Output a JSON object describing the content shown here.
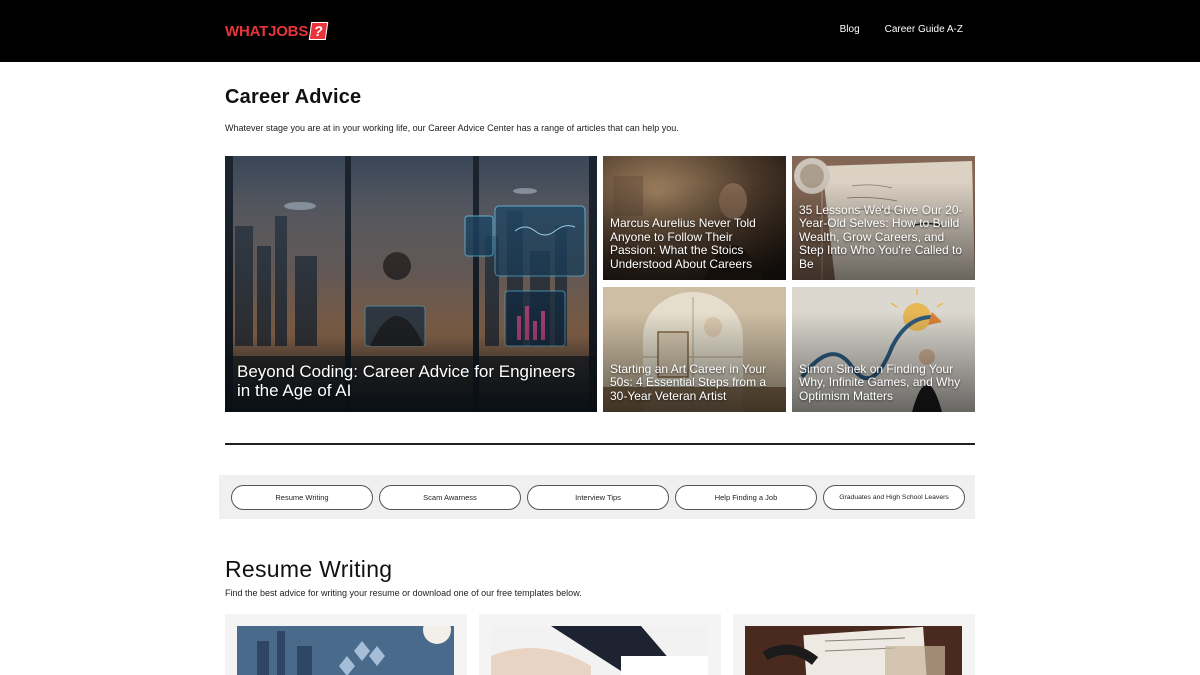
{
  "header": {
    "logo": {
      "text": "WHATJOBS",
      "badge": "?"
    },
    "nav": [
      {
        "label": "Blog"
      },
      {
        "label": "Career Guide A-Z"
      }
    ]
  },
  "hero": {
    "title": "Career Advice",
    "intro": "Whatever stage you are at in your working life, our Career Advice Center has a range of articles that can help you."
  },
  "featured": [
    {
      "title": "Beyond Coding: Career Advice for Engineers in the Age of AI",
      "image": "futuristic-engineer-dashboard"
    },
    {
      "title": "Marcus Aurelius Never Told Anyone to Follow Their Passion: What the Stoics Understood About Careers",
      "image": "stoic-philosopher"
    },
    {
      "title": "35 Lessons We'd Give Our 20-Year-Old Selves: How to Build Wealth, Grow Careers, and Step Into Who You're Called to Be",
      "image": "handwritten-notebook"
    },
    {
      "title": "Starting an Art Career in Your 50s: 4 Essential Steps from a 30-Year Veteran Artist",
      "image": "artist-at-easel"
    },
    {
      "title": "Simon Sinek on Finding Your Why, Infinite Games, and Why Optimism Matters",
      "image": "speaker-on-stage"
    }
  ],
  "categories": [
    {
      "label": "Resume Writing"
    },
    {
      "label": "Scam Awarness"
    },
    {
      "label": "Interview Tips"
    },
    {
      "label": "Help Finding a Job"
    },
    {
      "label": "Graduates and High School Leavers"
    }
  ],
  "section": {
    "title": "Resume Writing",
    "intro": "Find the best advice for writing your resume or download one of our free templates below."
  },
  "resume_cards": [
    {
      "image": "city-skyline-office"
    },
    {
      "image": "handshake-meeting"
    },
    {
      "image": "signing-documents"
    }
  ],
  "colors": {
    "brand_red": "#e8343a",
    "header_bg": "#000000",
    "tab_bar_bg": "#f0f0f0"
  }
}
